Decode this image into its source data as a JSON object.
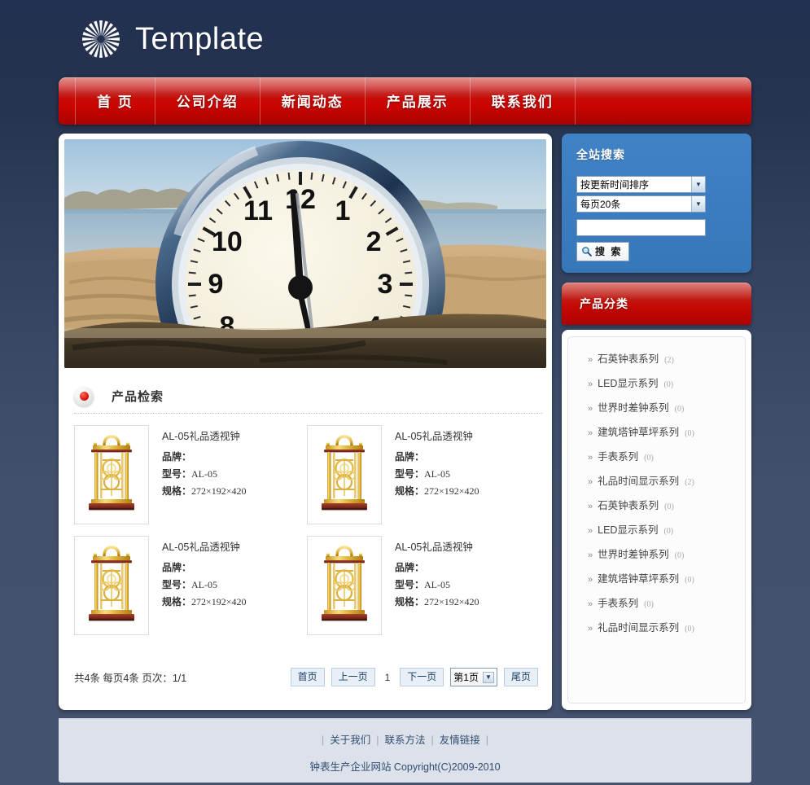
{
  "site": {
    "title": "Template",
    "logo_icon": "sunburst-icon",
    "accent_red": "#c30e07",
    "accent_blue": "#3b7cc0",
    "page_bg": "#3b4a67"
  },
  "nav": {
    "items": [
      {
        "label": "首 页"
      },
      {
        "label": "公司介绍"
      },
      {
        "label": "新闻动态"
      },
      {
        "label": "产品展示"
      },
      {
        "label": "联系我们"
      }
    ]
  },
  "banner": {
    "alt": "beach-clock-photo"
  },
  "section": {
    "bullet_icon": "red-dot-icon",
    "title": "产品检索"
  },
  "products": [
    {
      "name": "AL-05礼品透视钟",
      "brand_label": "品牌：",
      "brand_value": "",
      "model_label": "型号：",
      "model_value": "AL-05",
      "spec_label": "规格：",
      "spec_value": "272×192×420",
      "image_icon": "gold-skeleton-clock-thumb"
    },
    {
      "name": "AL-05礼品透视钟",
      "brand_label": "品牌：",
      "brand_value": "",
      "model_label": "型号：",
      "model_value": "AL-05",
      "spec_label": "规格：",
      "spec_value": "272×192×420",
      "image_icon": "gold-skeleton-clock-thumb"
    },
    {
      "name": "AL-05礼品透视钟",
      "brand_label": "品牌：",
      "brand_value": "",
      "model_label": "型号：",
      "model_value": "AL-05",
      "spec_label": "规格：",
      "spec_value": "272×192×420",
      "image_icon": "gold-skeleton-clock-thumb"
    },
    {
      "name": "AL-05礼品透视钟",
      "brand_label": "品牌：",
      "brand_value": "",
      "model_label": "型号：",
      "model_value": "AL-05",
      "spec_label": "规格：",
      "spec_value": "272×192×420",
      "image_icon": "gold-skeleton-clock-thumb"
    }
  ],
  "pager": {
    "stat": "共4条 每页4条 页次：1/1",
    "first": "首页",
    "prev": "上一页",
    "current": "1",
    "next": "下一页",
    "select_value": "第1页",
    "select_arrow": "▼",
    "last": "尾页"
  },
  "search": {
    "title": "全站搜索",
    "sort_value": "按更新时间排序",
    "perpage_value": "每页20条",
    "keyword_value": "",
    "keyword_placeholder": "",
    "button_label": "搜 索",
    "button_icon": "magnifier-icon",
    "dropdown_arrow": "▼"
  },
  "categories": {
    "header": "产品分类",
    "chevron": "»",
    "items": [
      {
        "label": "石英钟表系列",
        "count": "(2)"
      },
      {
        "label": "LED显示系列",
        "count": "(0)"
      },
      {
        "label": "世界时差钟系列",
        "count": "(0)"
      },
      {
        "label": "建筑塔钟草坪系列",
        "count": "(0)"
      },
      {
        "label": "手表系列",
        "count": "(0)"
      },
      {
        "label": "礼品时间显示系列",
        "count": "(2)"
      },
      {
        "label": "石英钟表系列",
        "count": "(0)"
      },
      {
        "label": "LED显示系列",
        "count": "(0)"
      },
      {
        "label": "世界时差钟系列",
        "count": "(0)"
      },
      {
        "label": "建筑塔钟草坪系列",
        "count": "(0)"
      },
      {
        "label": "手表系列",
        "count": "(0)"
      },
      {
        "label": "礼品时间显示系列",
        "count": "(0)"
      }
    ]
  },
  "footer": {
    "links": [
      {
        "label": "关于我们"
      },
      {
        "label": "联系方法"
      },
      {
        "label": "友情链接"
      }
    ],
    "separator": "|",
    "copyright": "钟表生产企业网站  Copyright(C)2009-2010"
  }
}
